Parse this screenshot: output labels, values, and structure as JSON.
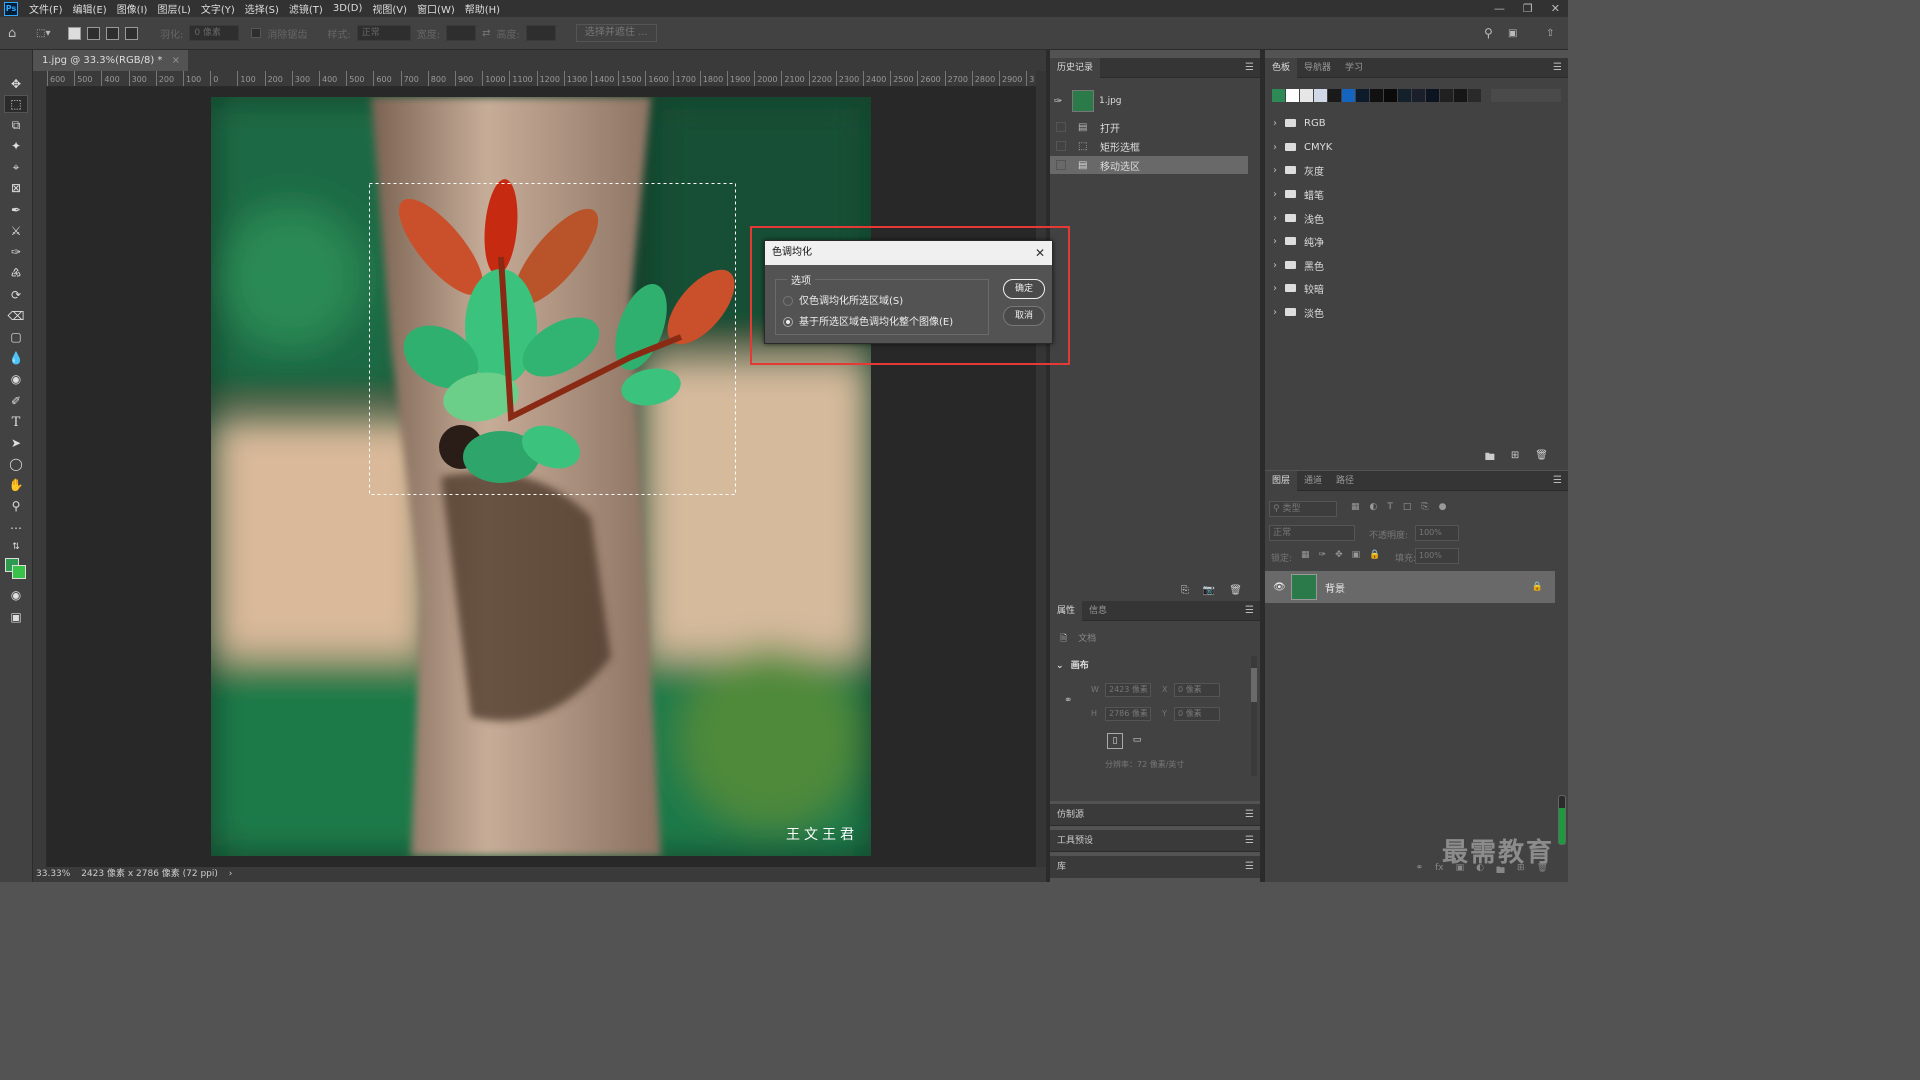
{
  "app": {
    "logo": "Ps"
  },
  "menu": [
    "文件(F)",
    "编辑(E)",
    "图像(I)",
    "图层(L)",
    "文字(Y)",
    "选择(S)",
    "滤镜(T)",
    "3D(D)",
    "视图(V)",
    "窗口(W)",
    "帮助(H)"
  ],
  "options_bar": {
    "feather_label": "羽化:",
    "feather_value": "0 像素",
    "antialias_label": "消除锯齿",
    "style_label": "样式:",
    "style_value": "正常",
    "width_label": "宽度:",
    "height_label": "高度:",
    "select_mask_label": "选择并遮住 ..."
  },
  "document": {
    "tab_title": "1.jpg @ 33.3%(RGB/8) *",
    "ruler_ticks": [
      "600",
      "500",
      "400",
      "300",
      "200",
      "100",
      "0",
      "100",
      "200",
      "300",
      "400",
      "500",
      "600",
      "700",
      "800",
      "900",
      "1000",
      "1100",
      "1200",
      "1300",
      "1400",
      "1500",
      "1600",
      "1700",
      "1800",
      "1900",
      "2000",
      "2100",
      "2200",
      "2300",
      "2400",
      "2500",
      "2600",
      "2700",
      "2800",
      "2900",
      "3"
    ],
    "watermark": "王文王君",
    "status_zoom": "33.33%",
    "status_info": "2423 像素 x 2786 像素 (72 ppi)"
  },
  "history": {
    "tab_label": "历史记录",
    "snapshot": "1.jpg",
    "items": [
      "打开",
      "矩形选框",
      "移动选区"
    ]
  },
  "swatches": {
    "tabs": [
      "色板",
      "导航器",
      "学习"
    ],
    "recent_colors": [
      "#2d8a56",
      "#ffffff",
      "#e6e6e6",
      "#d0d8e8",
      "#1a1a1a",
      "#1565c0",
      "#0d1b2a",
      "#111111",
      "#0a0a0a",
      "#14202a",
      "#1a1f2b",
      "#0b1420",
      "#202020",
      "#161616",
      "#2a2a2a"
    ],
    "groups": [
      "RGB",
      "CMYK",
      "灰度",
      "蜡笔",
      "浅色",
      "纯净",
      "黑色",
      "较暗",
      "淡色"
    ]
  },
  "properties": {
    "tabs": [
      "属性",
      "信息"
    ],
    "doc_label": "文档",
    "section_label": "画布",
    "w_label": "W",
    "w_value": "2423 像素",
    "h_label": "H",
    "h_value": "2786 像素",
    "x_label": "X",
    "x_value": "0 像素",
    "y_label": "Y",
    "y_value": "0 像素",
    "resolution": "分辨率：72 像素/英寸"
  },
  "collapsed_panels": [
    "仿制源",
    "工具预设",
    "库"
  ],
  "layers": {
    "tabs": [
      "图层",
      "通道",
      "路径"
    ],
    "kind_placeholder": "类型",
    "blend_mode": "正常",
    "opacity_label": "不透明度:",
    "opacity_value": "100%",
    "lock_label": "锁定:",
    "fill_label": "填充:",
    "fill_value": "100%",
    "layer_name": "背景"
  },
  "dialog": {
    "title": "色调均化",
    "group_label": "选项",
    "option1": "仅色调均化所选区域(S)",
    "option2": "基于所选区域色调均化整个图像(E)",
    "selected_option": 2,
    "ok_label": "确定",
    "cancel_label": "取消"
  },
  "site_watermark": "最需教育",
  "highlight_color": "#e53935"
}
